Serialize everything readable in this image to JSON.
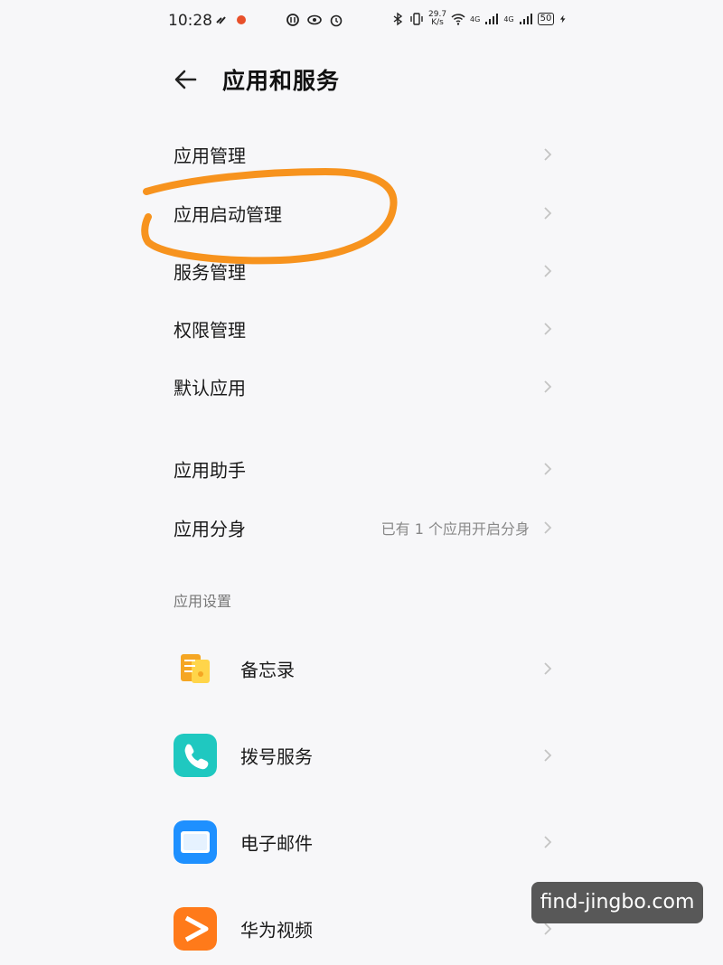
{
  "status_bar": {
    "time": "10:28",
    "net_speed_value": "29.7",
    "net_speed_unit": "K/s",
    "signal_label_1": "4G",
    "signal_label_2": "4G",
    "battery": "50"
  },
  "header": {
    "title": "应用和服务"
  },
  "menu": {
    "items": [
      {
        "label": "应用管理"
      },
      {
        "label": "应用启动管理"
      },
      {
        "label": "服务管理"
      },
      {
        "label": "权限管理"
      },
      {
        "label": "默认应用"
      },
      {
        "label": "应用助手"
      },
      {
        "label": "应用分身",
        "value": "已有 1 个应用开启分身"
      }
    ]
  },
  "app_settings": {
    "header": "应用设置",
    "apps": [
      {
        "label": "备忘录",
        "icon": "memo-icon",
        "color": "#f5a623"
      },
      {
        "label": "拨号服务",
        "icon": "phone-icon",
        "color": "#1fc8c0"
      },
      {
        "label": "电子邮件",
        "icon": "email-icon",
        "color": "#1e90ff"
      },
      {
        "label": "华为视频",
        "icon": "video-icon",
        "color": "#ff7a1a"
      }
    ]
  },
  "annotation": {
    "color": "#f7931e"
  },
  "watermark": "find-jingbo.com"
}
